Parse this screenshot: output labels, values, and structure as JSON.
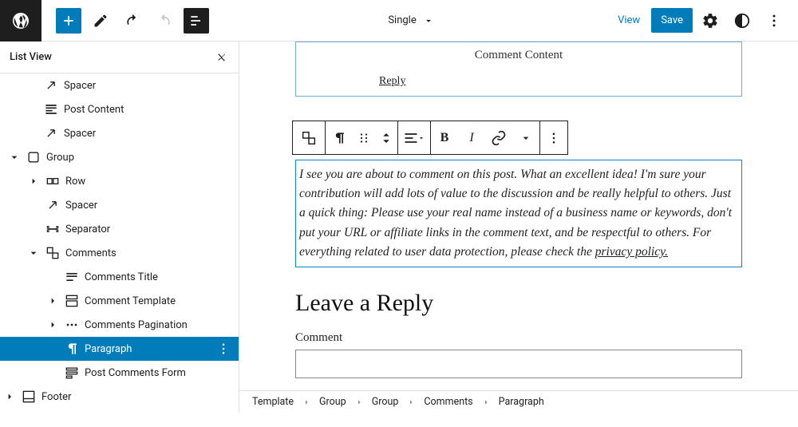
{
  "topbar": {
    "doc_title": "Single",
    "view": "View",
    "save": "Save"
  },
  "sidebar": {
    "title": "List View",
    "items": [
      {
        "label": "Spacer",
        "icon": "spacer",
        "depth": 1,
        "caret": ""
      },
      {
        "label": "Post Content",
        "icon": "content",
        "depth": 1,
        "caret": ""
      },
      {
        "label": "Spacer",
        "icon": "spacer",
        "depth": 1,
        "caret": ""
      },
      {
        "label": "Group",
        "icon": "group",
        "depth": 0,
        "caret": "down"
      },
      {
        "label": "Row",
        "icon": "row",
        "depth": 2,
        "caret": "right"
      },
      {
        "label": "Spacer",
        "icon": "spacer",
        "depth": 2,
        "caret": ""
      },
      {
        "label": "Separator",
        "icon": "separator",
        "depth": 2,
        "caret": ""
      },
      {
        "label": "Comments",
        "icon": "comments",
        "depth": 2,
        "caret": "down"
      },
      {
        "label": "Comments Title",
        "icon": "ctitle",
        "depth": 3,
        "caret": ""
      },
      {
        "label": "Comment Template",
        "icon": "ctemplate",
        "depth": 3,
        "caret": "right"
      },
      {
        "label": "Comments Pagination",
        "icon": "cpag",
        "depth": 3,
        "caret": "right"
      },
      {
        "label": "Paragraph",
        "icon": "paragraph",
        "depth": 3,
        "caret": "",
        "selected": true
      },
      {
        "label": "Post Comments Form",
        "icon": "cform",
        "depth": 3,
        "caret": ""
      },
      {
        "label": "Footer",
        "icon": "footer",
        "depth": -1,
        "caret": "right"
      }
    ]
  },
  "canvas": {
    "prev_title": "Comment Content",
    "prev_reply": "Reply",
    "paragraph_main": "I see you are about to comment on this post. What an excellent idea! I'm sure your contribution will add lots of value to the discussion and be really helpful to others. Just a quick thing: Please use your real name instead of a business name or keywords, don't put your URL or affiliate links in the comment text, and be respectful to others. For everything related to user data protection, please check the ",
    "paragraph_link": "privacy policy.",
    "leave_reply": "Leave a Reply",
    "comment_label": "Comment"
  },
  "breadcrumb": [
    "Template",
    "Group",
    "Group",
    "Comments",
    "Paragraph"
  ]
}
